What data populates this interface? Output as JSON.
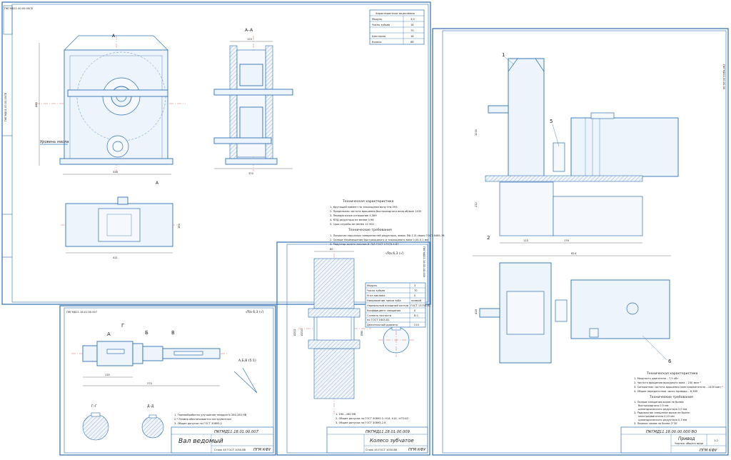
{
  "sheet_reducer": {
    "stamp_rotated": "ПКГМД11.00.00.00СБ",
    "section_label": "А–А",
    "view_mark_top": "А",
    "view_mark_bottom": "А",
    "oil_level_label": "Уровень масла",
    "table_title": "Характеристики зацепления",
    "table_rows": [
      {
        "k": "Модуль",
        "v": "3,0"
      },
      {
        "k": "Число зубьев",
        "v": "18"
      },
      {
        "k": "",
        "v": "70"
      },
      {
        "k": "Шестерня",
        "v": "16"
      },
      {
        "k": "Колеса",
        "v": "86"
      }
    ],
    "dims": [
      "446",
      "338",
      "400",
      "120",
      "370",
      "411",
      "160",
      "153",
      "42"
    ],
    "tech_title": "Техническая характеристика",
    "tech_lines": [
      "1. Крутящий момент на тихоходном валу Н·м  293",
      "2. Предельная частота вращения быстроходного вала об/мин  1435",
      "3. Передаточное отношение  4,389",
      "4. КПД редуктора не менее  0,96",
      "5. Срок службы не менее  10 500"
    ],
    "req_title": "Технические требования",
    "req_lines": [
      "1. Покрытие наружных поверхностей редуктора, эмаль ПФ-115 серая ГОСТ 6465-76",
      "2. Осевые перемещения быстроходного и тихоходного вала 0,05-0,1 мм",
      "3. Редуктор залить маслом И-70А ГОСТ 17479.4-87"
    ]
  },
  "sheet_drive": {
    "stamp_rotated": "ПКГМД11.00.00.00",
    "callouts": [
      "1",
      "5",
      "2",
      "6"
    ],
    "dims": [
      "1000",
      "212",
      "115",
      "176",
      "530",
      "624",
      "418"
    ],
    "tech_title": "Техническая характеристика",
    "tech_lines": [
      "1. Мощность двигателя – 7,5 кВт",
      "2. Частота вращения выходного вала – 230 мин⁻¹",
      "3. Синхронная частота вращения электродвигателя – 1435 мин⁻¹",
      "4. Общее передаточное число привода – 6,389"
    ],
    "req_title": "Технические требования",
    "req_lines": [
      "1. Осевые смещения валов не более:",
      "быстроходного  0,5 мм",
      "цилиндрического редуктора  2,0 мм",
      "2. Радиальное смещение валов не более:",
      "электродвигателя  0,15 мм",
      "цилиндрического редуктора  0,3 мм",
      "3. Перекос валов не более  0°30'"
    ],
    "title_code": "ПКГМД11.18.00.00.000 ВО",
    "title_name": "Привод",
    "title_sub": "Чертеж общего вида",
    "title_org": "ПГМ КФУ",
    "title_scale": "1:2"
  },
  "sheet_shaft": {
    "stamp_rotated": "ПКГМД11.18.01.00.007",
    "roughness": "√Ra 6,3 (√)",
    "section_marks": [
      "А",
      "Б",
      "В",
      "Г",
      "Д"
    ],
    "view_abv": "А,Б,В (5:1)",
    "section_gg": "Г–Г",
    "section_dd": "Д–Д",
    "dims": [
      "135",
      "116",
      "270",
      "155"
    ],
    "notes": [
      "1. Термообработка улучшение твердость 260.280 HB",
      "2.* Размер обеспечивается инструментом",
      "3. Общие допуски по ГОСТ 30893.2"
    ],
    "title_code": "ПКГМД11.18.01.00.007",
    "title_name": "Вал ведомый",
    "title_material": "Сталь 45 ГОСТ 1050-88",
    "title_org": "ПГМ КФУ"
  },
  "sheet_gear": {
    "stamp_rotated": "ПКГМД11.18.01.00.009",
    "roughness": "√Ra 6,3 (√)",
    "param_rows": [
      {
        "k": "Модуль",
        "v": "3"
      },
      {
        "k": "Число зубьев",
        "v": "70"
      },
      {
        "k": "Угол наклона",
        "v": "0"
      },
      {
        "k": "Направление линии зуба",
        "v": "прямой"
      },
      {
        "k": "Нормальный исходный контур",
        "v": "ГОСТ 13755-81"
      },
      {
        "k": "Коэффициент смещения",
        "v": "0"
      },
      {
        "k": "Степень точности",
        "v": "8-С"
      },
      {
        "k": "по ГОСТ 1643-81",
        "v": ""
      },
      {
        "k": "Делительный диаметр",
        "v": "210"
      }
    ],
    "dims": [
      "80",
      "50",
      "Ø212",
      "Ø210",
      "Ø60"
    ],
    "notes": [
      "1. 190...160 НВ",
      "2. Общие допуски по ГОСТ 30893.1: H14, h14, ±IT14/2",
      "3. Общие допуски по ГОСТ 30893.2-К"
    ],
    "title_code": "ПКГМД11.18.01.00.009",
    "title_name": "Колесо зубчатое",
    "title_material": "Сталь 45 ГОСТ 1050-88",
    "title_org": "ПГМ КФУ"
  }
}
